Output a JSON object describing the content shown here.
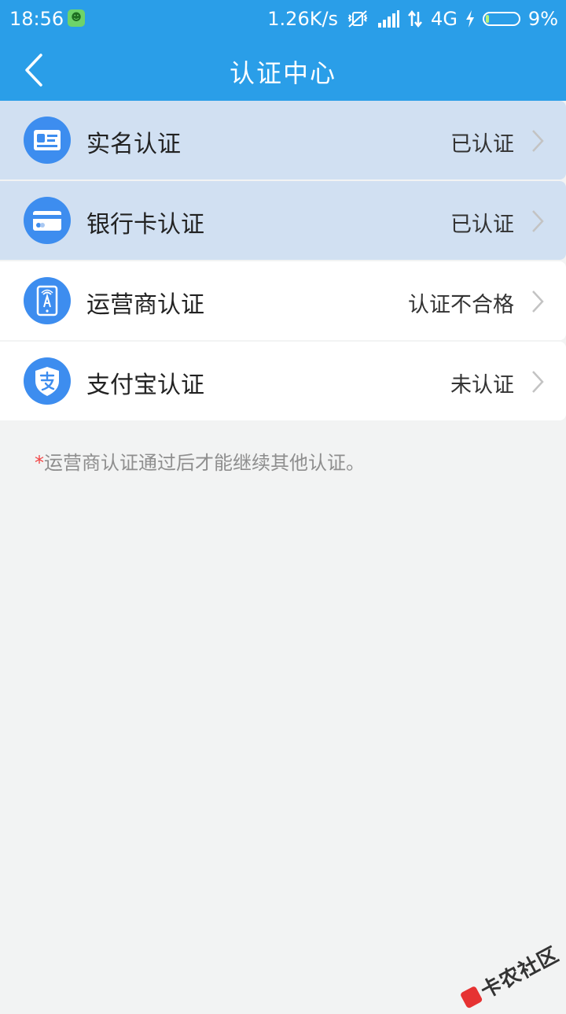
{
  "status_bar": {
    "time": "18:56",
    "app_badge_icon": "frog-icon",
    "net_speed": "1.26K/s",
    "network": "4G",
    "battery": "9%",
    "battery_level": 0.09
  },
  "nav": {
    "title": "认证中心",
    "back_icon": "chevron-left-icon"
  },
  "items": [
    {
      "label": "实名认证",
      "status": "已认证",
      "icon": "id-card-icon"
    },
    {
      "label": "银行卡认证",
      "status": "已认证",
      "icon": "bank-card-icon"
    },
    {
      "label": "运营商认证",
      "status": "认证不合格",
      "icon": "phone-tower-icon"
    },
    {
      "label": "支付宝认证",
      "status": "未认证",
      "icon": "alipay-shield-icon"
    }
  ],
  "note": {
    "star": "*",
    "text": "运营商认证通过后才能继续其他认证。"
  },
  "watermark": {
    "text": "卡农社区"
  },
  "colors": {
    "primary": "#2a9ee8",
    "icon_bg": "#3d8def",
    "verified_row": "#d1e0f2",
    "background": "#f2f3f3",
    "required_star": "#f14646"
  }
}
